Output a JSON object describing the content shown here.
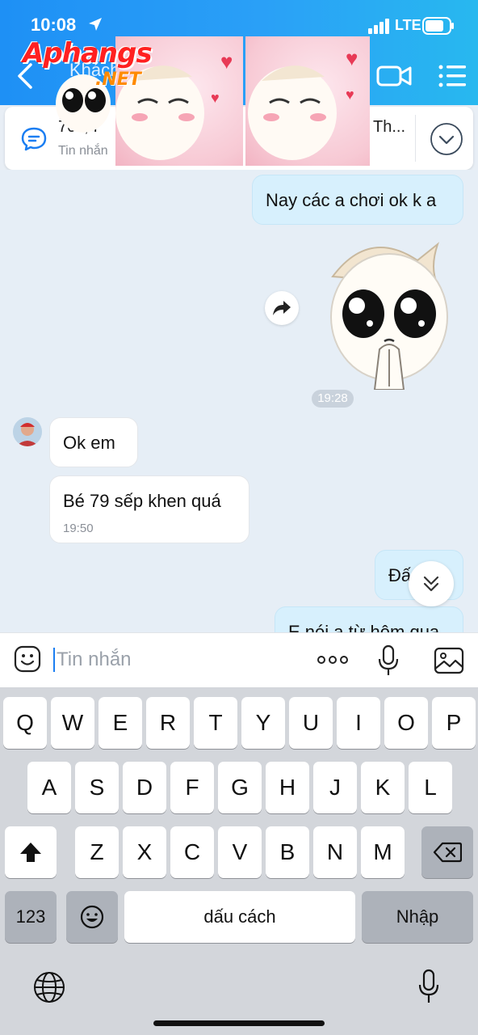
{
  "status": {
    "time": "10:08",
    "network": "LTE"
  },
  "header": {
    "name_partial": "Khách"
  },
  "watermark": {
    "brand": "Aphangs",
    "suffix": ".NET"
  },
  "pinned": {
    "title": "70k, I",
    "title_right": "Th...",
    "subtitle": "Tin nhắn"
  },
  "messages": {
    "out1": "Nay các a chơi ok k a",
    "sticker_time": "19:28",
    "in1": "Ok em",
    "in2": "Bé 79 sếp khen quá",
    "in2_time": "19:50",
    "out2": "Đấ",
    "out3": "E nói a từ hôm qua"
  },
  "input": {
    "placeholder": "Tin nhắn"
  },
  "keyboard": {
    "row1": [
      "Q",
      "W",
      "E",
      "R",
      "T",
      "Y",
      "U",
      "I",
      "O",
      "P"
    ],
    "row2": [
      "A",
      "S",
      "D",
      "F",
      "G",
      "H",
      "J",
      "K",
      "L"
    ],
    "row3": [
      "Z",
      "X",
      "C",
      "V",
      "B",
      "N",
      "M"
    ],
    "numbers": "123",
    "space": "dấu cách",
    "enter": "Nhập"
  },
  "colors": {
    "header": "#1e90f5",
    "outgoing_bubble": "#d7f0fd",
    "keyboard_bg": "#d3d6db"
  }
}
